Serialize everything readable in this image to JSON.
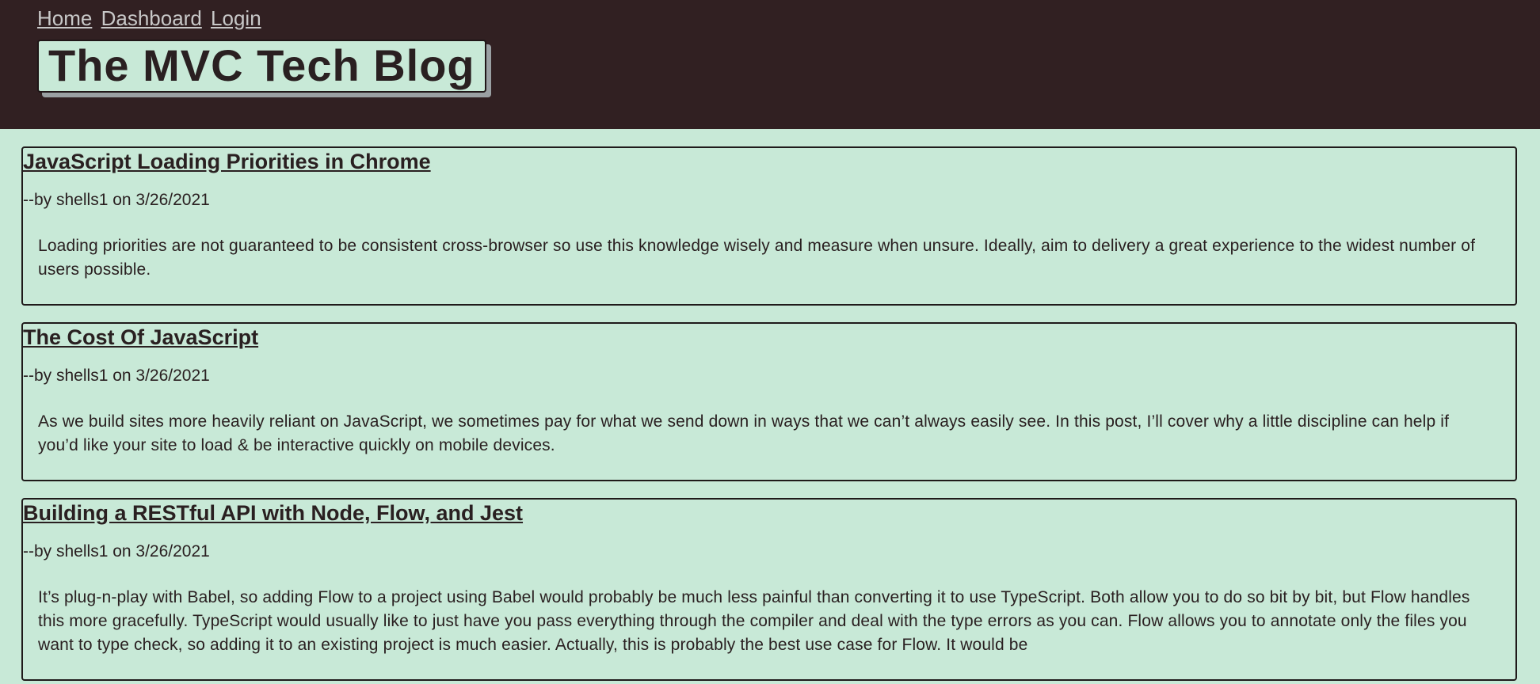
{
  "nav": {
    "home": "Home",
    "dashboard": "Dashboard",
    "login": "Login"
  },
  "header": {
    "title": "The MVC Tech Blog"
  },
  "posts": [
    {
      "title": "JavaScript Loading Priorities in Chrome",
      "meta": "--by shells1 on 3/26/2021",
      "body": "Loading priorities are not guaranteed to be consistent cross-browser so use this knowledge wisely and measure when unsure. Ideally, aim to delivery a great experience to the widest number of users possible."
    },
    {
      "title": "The Cost Of JavaScript",
      "meta": "--by shells1 on 3/26/2021",
      "body": "As we build sites more heavily reliant on JavaScript, we sometimes pay for what we send down in ways that we can’t always easily see. In this post, I’ll cover why a little discipline can help if you’d like your site to load & be interactive quickly on mobile devices."
    },
    {
      "title": "Building a RESTful API with Node, Flow, and Jest",
      "meta": "--by shells1 on 3/26/2021",
      "body": "It’s plug-n-play with Babel, so adding Flow to a project using Babel would probably be much less painful than converting it to use TypeScript. Both allow you to do so bit by bit, but Flow handles this more gracefully. TypeScript would usually like to just have you pass everything through the compiler and deal with the type errors as you can. Flow allows you to annotate only the files you want to type check, so adding it to an existing project is much easier. Actually, this is probably the best use case for Flow. It would be"
    }
  ],
  "colors": {
    "page_background": "#c8e9d7",
    "header_background": "#312022",
    "nav_link": "#c8c8c8",
    "text": "#2a2021"
  }
}
